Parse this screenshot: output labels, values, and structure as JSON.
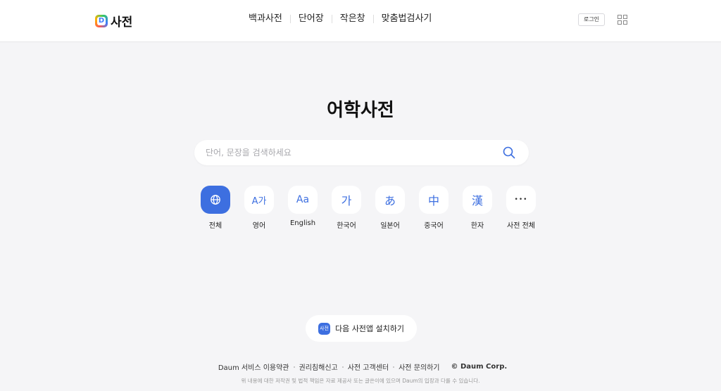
{
  "header": {
    "logo_text": "사전",
    "nav": [
      "백과사전",
      "단어장",
      "작은창",
      "맞춤법검사기"
    ],
    "login_label": "로그인"
  },
  "main": {
    "title": "어학사전",
    "search": {
      "placeholder": "단어, 문장을 검색하세요",
      "value": ""
    },
    "dictionaries": [
      {
        "icon_name": "globe-icon",
        "glyph": "",
        "label": "전체",
        "active": true
      },
      {
        "icon_name": "english-korean-icon",
        "glyph": "A가",
        "label": "영어",
        "active": false
      },
      {
        "icon_name": "english-icon",
        "glyph": "Aa",
        "label": "English",
        "active": false
      },
      {
        "icon_name": "korean-icon",
        "glyph": "가",
        "label": "한국어",
        "active": false
      },
      {
        "icon_name": "japanese-icon",
        "glyph": "あ",
        "label": "일본어",
        "active": false
      },
      {
        "icon_name": "chinese-icon",
        "glyph": "中",
        "label": "중국어",
        "active": false
      },
      {
        "icon_name": "hanja-icon",
        "glyph": "漢",
        "label": "한자",
        "active": false
      },
      {
        "icon_name": "more-icon",
        "glyph": "•••",
        "label": "사전 전체",
        "active": false
      }
    ],
    "app_install": {
      "icon_text": "사전",
      "label": "다음 사전앱 설치하기"
    }
  },
  "footer": {
    "links": [
      "Daum 서비스 이용약관",
      "권리침해신고",
      "사전 고객센터",
      "사전 문의하기"
    ],
    "copyright": "© Daum Corp.",
    "notice": "위 내용에 대한 저작권 및 법적 책임은 자료 제공사 또는 글쓴이에 있으며 Daum의 입장과 다를 수 있습니다."
  },
  "colors": {
    "accent": "#3d6fe0",
    "background": "#f5f5f7",
    "header_bg": "#ffffff"
  }
}
